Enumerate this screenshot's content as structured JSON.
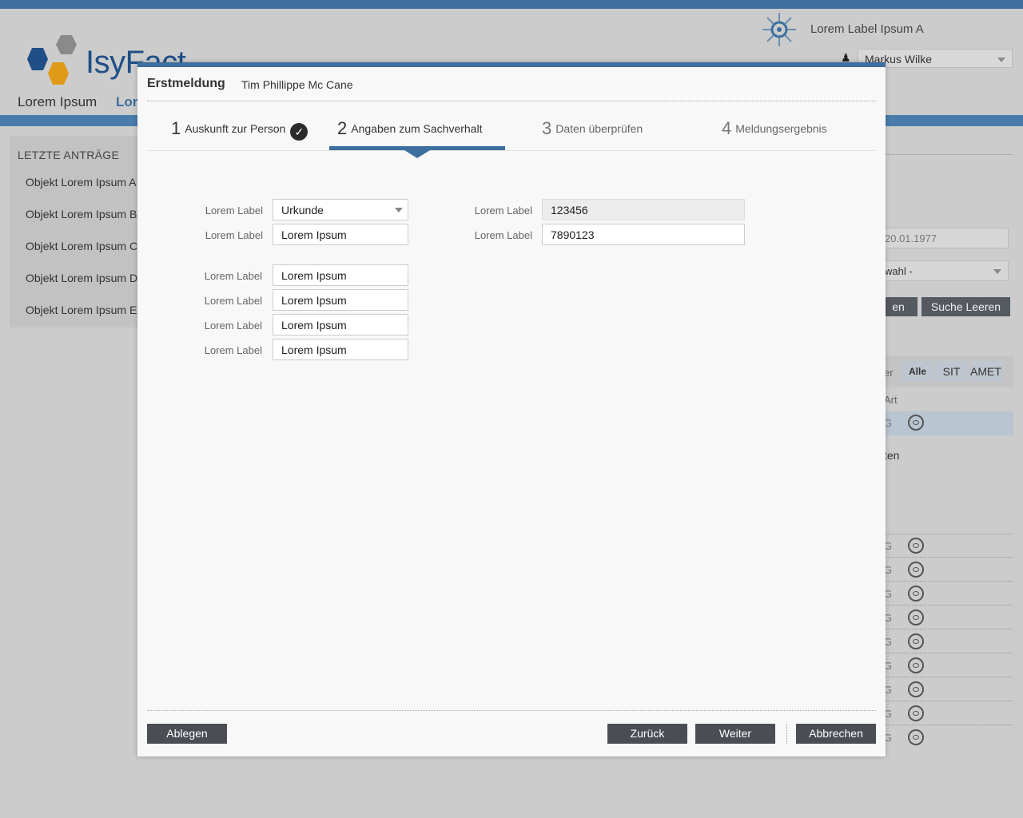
{
  "app": {
    "logo_text": "IsyFact",
    "title": "Lorem Label Ipsum A",
    "user": "Markus Wilke",
    "nav": [
      "Lorem Ipsum",
      "Lor"
    ]
  },
  "sidebar": {
    "title": "LETZTE ANTRÄGE",
    "items": [
      "Objekt Lorem Ipsum A",
      "Objekt Lorem Ipsum B",
      "Objekt Lorem Ipsum C",
      "Objekt Lorem Ipsum D",
      "Objekt Lorem Ipsum E"
    ]
  },
  "background_right": {
    "date_value": "20.01.1977",
    "select_value": "wahl -",
    "search_btn_partial": "en",
    "clear_btn": "Suche Leeren",
    "filter_label_partial": "er",
    "filters": [
      "Alle",
      "SIT",
      "AMET"
    ],
    "col_partial": "Art",
    "row_partial": "G",
    "section_partial": "ten"
  },
  "modal": {
    "title": "Erstmeldung",
    "subtitle": "Tim Phillippe Mc Cane",
    "steps": [
      {
        "num": "1",
        "label": "Auskunft zur Person",
        "done": true
      },
      {
        "num": "2",
        "label": "Angaben zum Sachverhalt",
        "active": true
      },
      {
        "num": "3",
        "label": "Daten überprüfen"
      },
      {
        "num": "4",
        "label": "Meldungsergebnis"
      }
    ],
    "check_glyph": "✓",
    "form": {
      "label": "Lorem Label",
      "select_value": "Urkunde",
      "left_field_1": "Lorem Ipsum",
      "group2": [
        "Lorem Ipsum",
        "Lorem Ipsum",
        "Lorem Ipsum",
        "Lorem Ipsum"
      ],
      "right_ro_value": "123456",
      "right_value": "7890123"
    },
    "buttons": {
      "ablegen": "Ablegen",
      "zurueck": "Zurück",
      "weiter": "Weiter",
      "abbrechen": "Abbrechen"
    }
  }
}
